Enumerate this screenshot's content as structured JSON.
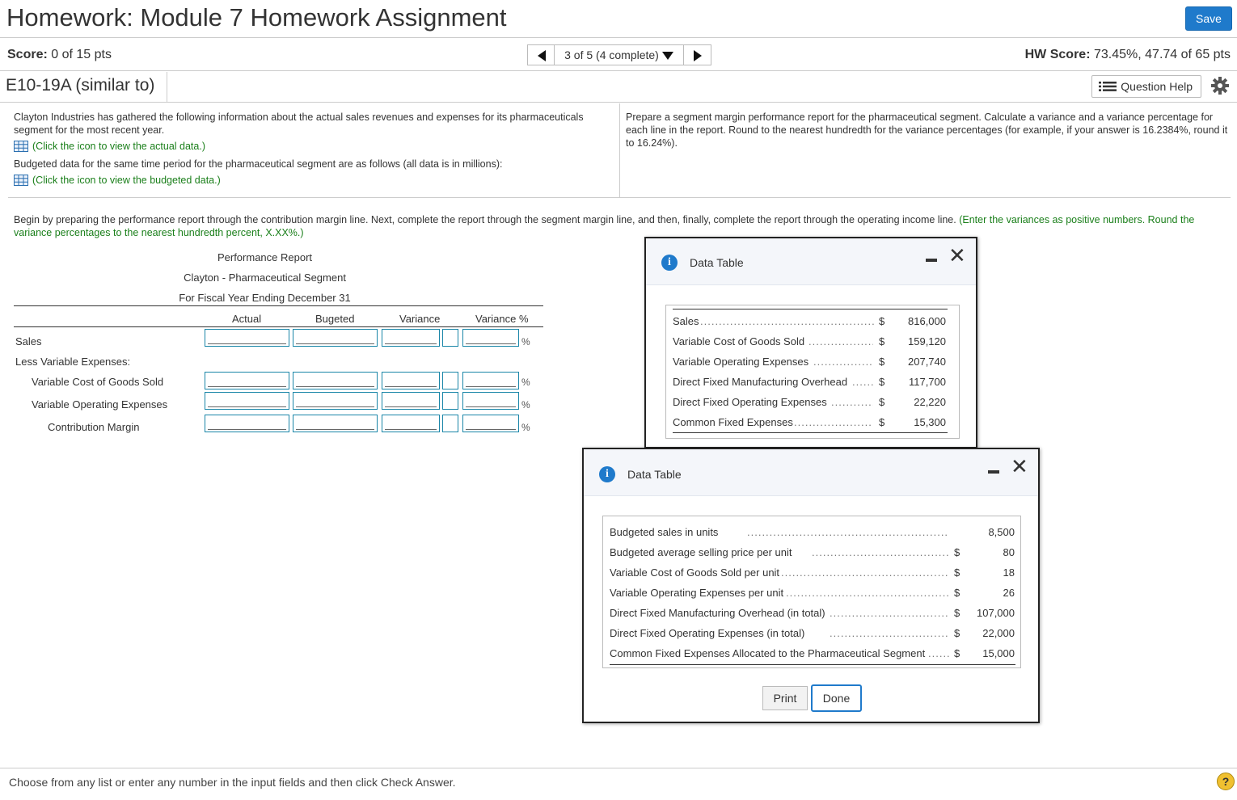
{
  "header": {
    "title": "Homework: Module 7 Homework Assignment",
    "save_label": "Save"
  },
  "scorebar": {
    "score_label": "Score:",
    "score_value": "0 of 15 pts",
    "nav_position": "3 of 5 (4 complete)",
    "hw_score_label": "HW Score:",
    "hw_score_value": "73.45%, 47.74 of 65 pts"
  },
  "question": {
    "id": "E10-19A (similar to)",
    "help_label": "Question Help"
  },
  "prompt": {
    "para1": "Clayton Industries has gathered the following information about the actual sales revenues and expenses for its pharmaceuticals segment for the most recent year.",
    "link1": "(Click the icon to view the actual data.)",
    "para2": "Budgeted data for the same time period for the pharmaceutical segment are as follows (all data is in millions):",
    "link2": "(Click the icon to view the budgeted data.)",
    "right": "Prepare a segment margin performance report for the pharmaceutical segment. Calculate a variance and a variance percentage for each line in the report. Round to the nearest hundredth for the variance percentages (for example, if your answer is 16.2384%, round it to 16.24%)."
  },
  "instructions": {
    "main": "Begin by preparing the performance report through the contribution margin line. Next, complete the report through the segment margin line, and then, finally, complete the report through the operating income line.",
    "green": "(Enter the variances as positive numbers. Round the variance percentages to the nearest hundredth percent, X.XX%.)"
  },
  "report": {
    "title": "Performance Report",
    "subtitle": "Clayton - Pharmaceutical Segment",
    "period": "For Fiscal Year Ending December 31",
    "columns": [
      "Actual",
      "Bugeted",
      "Variance",
      "Variance %"
    ],
    "rows": [
      {
        "label": "Sales"
      },
      {
        "label": "Less Variable Expenses:"
      },
      {
        "label": "Variable Cost of Goods Sold"
      },
      {
        "label": "Variable Operating Expenses"
      },
      {
        "label": "Contribution Margin"
      }
    ],
    "pct_symbol": "%"
  },
  "actual_table": {
    "title": "Data Table",
    "rows": [
      {
        "label": "Sales",
        "currency": "$",
        "value": "816,000"
      },
      {
        "label": "Variable Cost of Goods Sold",
        "currency": "$",
        "value": "159,120"
      },
      {
        "label": "Variable Operating Expenses",
        "currency": "$",
        "value": "207,740"
      },
      {
        "label": "Direct Fixed Manufacturing Overhead",
        "currency": "$",
        "value": "117,700"
      },
      {
        "label": "Direct Fixed Operating Expenses",
        "currency": "$",
        "value": "22,220"
      },
      {
        "label": "Common Fixed Expenses",
        "currency": "$",
        "value": "15,300"
      }
    ]
  },
  "budget_table": {
    "title": "Data Table",
    "rows": [
      {
        "label": "Budgeted sales in units",
        "currency": "",
        "value": "8,500"
      },
      {
        "label": "Budgeted average selling price per unit",
        "currency": "$",
        "value": "80"
      },
      {
        "label": "Variable Cost of Goods Sold per unit",
        "currency": "$",
        "value": "18"
      },
      {
        "label": "Variable Operating Expenses per unit",
        "currency": "$",
        "value": "26"
      },
      {
        "label": "Direct Fixed Manufacturing Overhead (in total)",
        "currency": "$",
        "value": "107,000"
      },
      {
        "label": "Direct Fixed Operating Expenses (in total)",
        "currency": "$",
        "value": "22,000"
      },
      {
        "label": "Common Fixed Expenses Allocated to the Pharmaceutical Segment",
        "currency": "$",
        "value": "15,000"
      }
    ],
    "print_label": "Print",
    "done_label": "Done"
  },
  "footer": {
    "text": "Choose from any list or enter any number in the input fields and then click Check Answer.",
    "help_symbol": "?"
  },
  "colors": {
    "accent": "#1f7acb",
    "link_green": "#1a7f1a",
    "input_border": "#1a86a8"
  }
}
